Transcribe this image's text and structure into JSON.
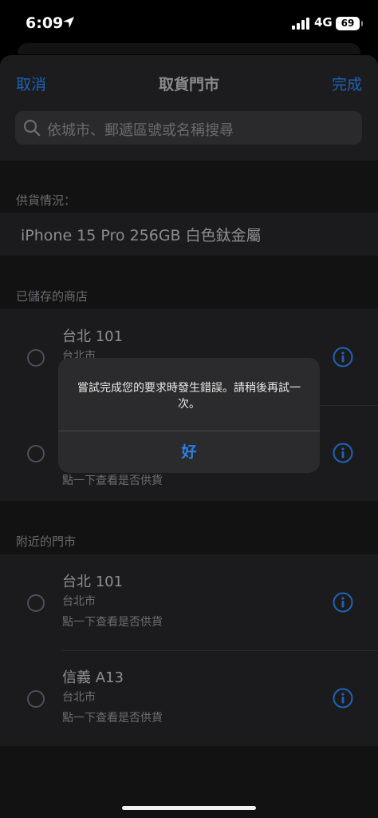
{
  "status_bar": {
    "time": "6:09",
    "network": "4G",
    "battery": "69"
  },
  "nav": {
    "cancel": "取消",
    "title": "取貨門市",
    "done": "完成"
  },
  "search": {
    "placeholder": "依城市、郵遞區號或名稱搜尋"
  },
  "availability": {
    "label": "供貨情況：",
    "product": "iPhone 15 Pro 256GB 白色鈦金屬"
  },
  "saved_stores": {
    "label": "已儲存的商店",
    "items": [
      {
        "name": "台北 101",
        "city": "台北市"
      },
      {
        "hint": "點一下查看是否供貨"
      }
    ]
  },
  "nearby_stores": {
    "label": "附近的門市",
    "items": [
      {
        "name": "台北 101",
        "city": "台北市",
        "hint": "點一下查看是否供貨"
      },
      {
        "name": "信義 A13",
        "city": "台北市",
        "hint": "點一下查看是否供貨"
      }
    ]
  },
  "alert": {
    "message": "嘗試完成您的要求時發生錯誤。請稍後再試一次。",
    "button": "好"
  },
  "colors": {
    "accent": "#2d7ee6",
    "background": "#000000"
  },
  "icons": [
    "location-arrow-icon",
    "signal-icon",
    "search-icon",
    "info-icon"
  ]
}
